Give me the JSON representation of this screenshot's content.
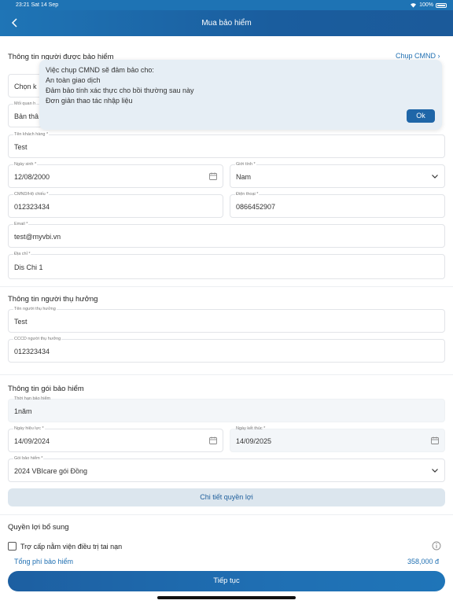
{
  "status_bar": {
    "time": "23:21",
    "date": "Sat 14 Sep",
    "battery": "100%"
  },
  "header": {
    "title": "Mua bảo hiểm",
    "back_icon": "chevron-left-icon"
  },
  "insured_section": {
    "title": "Thông tin người được bảo hiểm",
    "scan_link": "Chụp CMND",
    "select_partial": "Chọn k",
    "relation_label": "Mối quan h",
    "relation_value": "Bản thâ"
  },
  "tooltip": {
    "lines": [
      "Việc chụp CMND sẽ đảm bảo cho:",
      "An toàn giao dịch",
      "Đảm bảo tính xác thực cho bồi thường sau này",
      "Đơn giản thao tác nhập liệu"
    ],
    "ok_label": "Ok"
  },
  "fields": {
    "customer_name": {
      "label": "Tên khách hàng *",
      "value": "Test"
    },
    "dob": {
      "label": "Ngày sinh *",
      "value": "12/08/2000"
    },
    "gender": {
      "label": "Giới tính *",
      "value": "Nam"
    },
    "id_number": {
      "label": "CMND/Hộ chiếu *",
      "value": "012323434"
    },
    "phone": {
      "label": "Điện thoại *",
      "value": "0866452907"
    },
    "email": {
      "label": "Email *",
      "value": "test@myvbi.vn"
    },
    "address": {
      "label": "Địa chỉ *",
      "value": "Dis Chi 1"
    }
  },
  "beneficiary_section": {
    "title": "Thông tin người thụ hưởng",
    "name": {
      "label": "Tên người thụ hưởng",
      "value": "Test"
    },
    "id": {
      "label": "CCCD người thụ hưởng",
      "value": "012323434"
    }
  },
  "package_section": {
    "title": "Thông tin gói bảo hiểm",
    "term": {
      "label": "Thời hạn bảo hiểm",
      "value": "1năm"
    },
    "start_date": {
      "label": "Ngày hiệu lực *",
      "value": "14/09/2024"
    },
    "end_date": {
      "label": "Ngày kết thúc *",
      "value": "14/09/2025"
    },
    "package": {
      "label": "Gói bảo hiểm *",
      "value": "2024 VBIcare gói Đồng"
    },
    "details_button": "Chi tiết quyền lợi"
  },
  "additional_section": {
    "title": "Quyền lợi bổ sung",
    "option_1": "Trợ cấp nằm viện điều trị tai nạn"
  },
  "fee": {
    "label": "Tổng phí bảo hiểm",
    "value": "358,000 đ"
  },
  "continue_button": "Tiếp tục",
  "colors": {
    "primary": "#1f6fb2",
    "header": "#1a5d9e",
    "tooltip_bg": "#e6eef5"
  }
}
